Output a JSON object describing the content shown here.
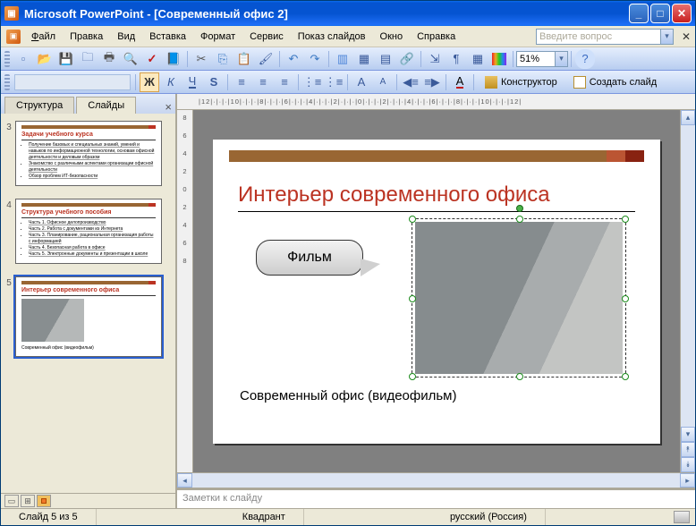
{
  "title": "Microsoft PowerPoint - [Современный офис 2]",
  "menu": {
    "file": "Файл",
    "edit": "Правка",
    "view": "Вид",
    "insert": "Вставка",
    "format": "Формат",
    "tools": "Сервис",
    "slideshow": "Показ слайдов",
    "window": "Окно",
    "help": "Справка"
  },
  "askbox": "Введите вопрос",
  "zoom": "51%",
  "designer": "Конструктор",
  "newslide": "Создать слайд",
  "left_tabs": {
    "structure": "Структура",
    "slides": "Слайды"
  },
  "thumbs": {
    "n3": "3",
    "t3_title": "Задачи учебного курса",
    "t3_items": [
      "Получение базовых и специальных знаний, умений и навыков по информационной технологии, основам офисной деятельности и деловым образом",
      "Знакомство с различными аспектами организации офисной деятельности",
      "Обзор проблем ИТ-безопасности"
    ],
    "n4": "4",
    "t4_title": "Структура учебного пособия",
    "t4_items": [
      "Часть 1. Офисное делопроизводство",
      "Часть 2. Работа с документами из Интернета",
      "Часть 3. Планирование, рациональная организация работы с информацией",
      "Часть 4. Безопасная работа в офисе",
      "Часть 5. Электронные документы и презентации в школе"
    ],
    "n5": "5",
    "t5_title": "Интерьер современного офиса",
    "t5_cap": "Современный офис (видеофильм)"
  },
  "ruler_h": "|12|·|·|·|10|·|·|·|8|·|·|·|6|·|·|·|4|·|·|·|2|·|·|·|0|·|·|·|2|·|·|·|4|·|·|·|6|·|·|·|8|·|·|·|10|·|·|·|12|",
  "ruler_v": [
    "8",
    "6",
    "4",
    "2",
    "0",
    "2",
    "4",
    "6",
    "8"
  ],
  "slide": {
    "title": "Интерьер современного офиса",
    "callout": "Фильм",
    "caption": "Современный офис (видеофильм)"
  },
  "notes": "Заметки к слайду",
  "status": {
    "slide": "Слайд 5 из 5",
    "template": "Квадрант",
    "lang": "русский (Россия)"
  }
}
